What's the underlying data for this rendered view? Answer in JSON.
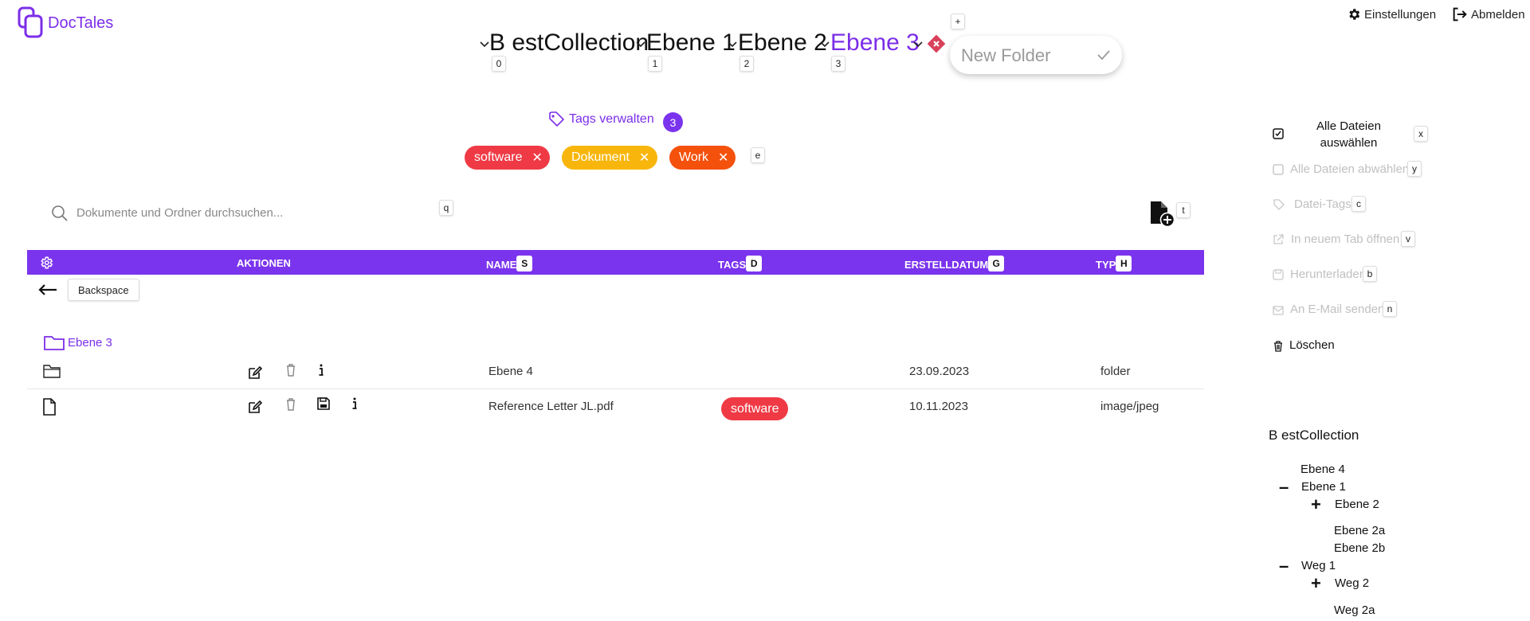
{
  "app": {
    "name": "DocTales"
  },
  "header": {
    "settings_label": "Einstellungen",
    "logout_label": "Abmelden"
  },
  "breadcrumb": {
    "items": [
      {
        "label": "B estCollection",
        "shortcut": "0"
      },
      {
        "label": "Ebene 1",
        "shortcut": "1"
      },
      {
        "label": "Ebene 2",
        "shortcut": "2"
      },
      {
        "label": "Ebene 3",
        "shortcut": "3"
      }
    ],
    "add_shortcut": "+",
    "new_folder_placeholder": "New Folder"
  },
  "tags": {
    "manage_label": "Tags verwalten",
    "count": "3",
    "shortcut": "e",
    "chips": [
      {
        "label": "software",
        "color": "#ef3a45"
      },
      {
        "label": "Dokument",
        "color": "#f8b60c"
      },
      {
        "label": "Work",
        "color": "#f4510d"
      }
    ]
  },
  "search": {
    "placeholder": "Dokumente und Ordner durchsuchen...",
    "shortcut": "q",
    "upload_shortcut": "t"
  },
  "table": {
    "accent": "#7b34ed",
    "headers": {
      "actions": "AKTIONEN",
      "name": "NAME",
      "name_shortcut": "S",
      "tags": "TAGS",
      "tags_shortcut": "D",
      "created": "ERSTELLDATUM",
      "created_shortcut": "G",
      "type": "TYP",
      "type_shortcut": "H"
    },
    "back_label": "Backspace",
    "current_folder": "Ebene 3",
    "rows": [
      {
        "name": "Ebene 4",
        "tag": "",
        "created": "23.09.2023",
        "type": "folder"
      },
      {
        "name": "Reference Letter JL.pdf",
        "tag": "software",
        "created": "10.11.2023",
        "type": "image/jpeg"
      }
    ]
  },
  "right_panel": {
    "select_all": "Alle Dateien auswählen",
    "select_all_shortcut": "x",
    "deselect_all": "Alle Dateien abwählen",
    "deselect_all_shortcut": "y",
    "file_tags": "Datei-Tags",
    "file_tags_shortcut": "c",
    "open_new_tab": "In neuem Tab öffnen",
    "open_new_tab_shortcut": "v",
    "download": "Herunterladen",
    "download_shortcut": "b",
    "email": "An E-Mail senden",
    "email_shortcut": "n",
    "delete": "Löschen"
  },
  "tree": {
    "root": "B estCollection",
    "items": [
      "Ebene 4",
      "Ebene 1",
      "Ebene 2",
      "Ebene 2a",
      "Ebene 2b",
      "Weg 1",
      "Weg 2",
      "Weg 2a"
    ],
    "expanded_symbol": "–",
    "collapsed_symbol": "+"
  }
}
